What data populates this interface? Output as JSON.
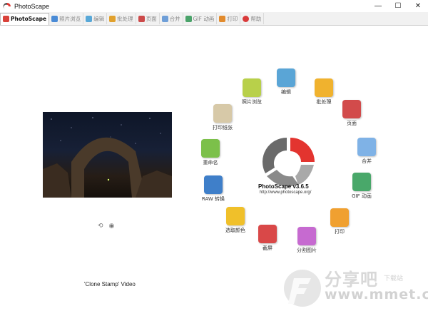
{
  "window": {
    "title": "PhotoScape",
    "minimize": "—",
    "maximize": "☐",
    "close": "✕"
  },
  "tabs": [
    {
      "label": "PhotoScape",
      "color": "#d9423a"
    },
    {
      "label": "照片浏览",
      "color": "#4a8bd6"
    },
    {
      "label": "编辑",
      "color": "#58a8d8"
    },
    {
      "label": "批处理",
      "color": "#e1a12d"
    },
    {
      "label": "页面",
      "color": "#cc4a4a"
    },
    {
      "label": "合并",
      "color": "#6f9fd8"
    },
    {
      "label": "GIF 动画",
      "color": "#4aa36a"
    },
    {
      "label": "打印",
      "color": "#e28b2d"
    },
    {
      "label": "帮助",
      "color": "#d93a3a"
    }
  ],
  "photo_caption": "'Clone Stamp' Video",
  "logo": {
    "name": "PhotoScape v3.6.5",
    "url": "http://www.photoscape.org/"
  },
  "menu": [
    {
      "label": "编辑",
      "color": "#5aa5d6"
    },
    {
      "label": "批处理",
      "color": "#f0b22e"
    },
    {
      "label": "页面",
      "color": "#d24b4b"
    },
    {
      "label": "合并",
      "color": "#7fb2e6"
    },
    {
      "label": "GIF 动画",
      "color": "#49a86a"
    },
    {
      "label": "打印",
      "color": "#f0a030"
    },
    {
      "label": "分割图片",
      "color": "#c66ad0"
    },
    {
      "label": "截屏",
      "color": "#d94848"
    },
    {
      "label": "选取颜色",
      "color": "#f0c02a"
    },
    {
      "label": "RAW 转换",
      "color": "#3f7fc9"
    },
    {
      "label": "重命名",
      "color": "#7cc04a"
    },
    {
      "label": "打印纸张",
      "color": "#d7c9a8"
    },
    {
      "label": "照片浏览",
      "color": "#b8d04a"
    }
  ],
  "watermark": {
    "brand": "分享吧",
    "sub": "下载站",
    "url": "www.mmet.cn"
  },
  "colors": {
    "logo_red": "#e3342f",
    "logo_gray": "#666666"
  }
}
